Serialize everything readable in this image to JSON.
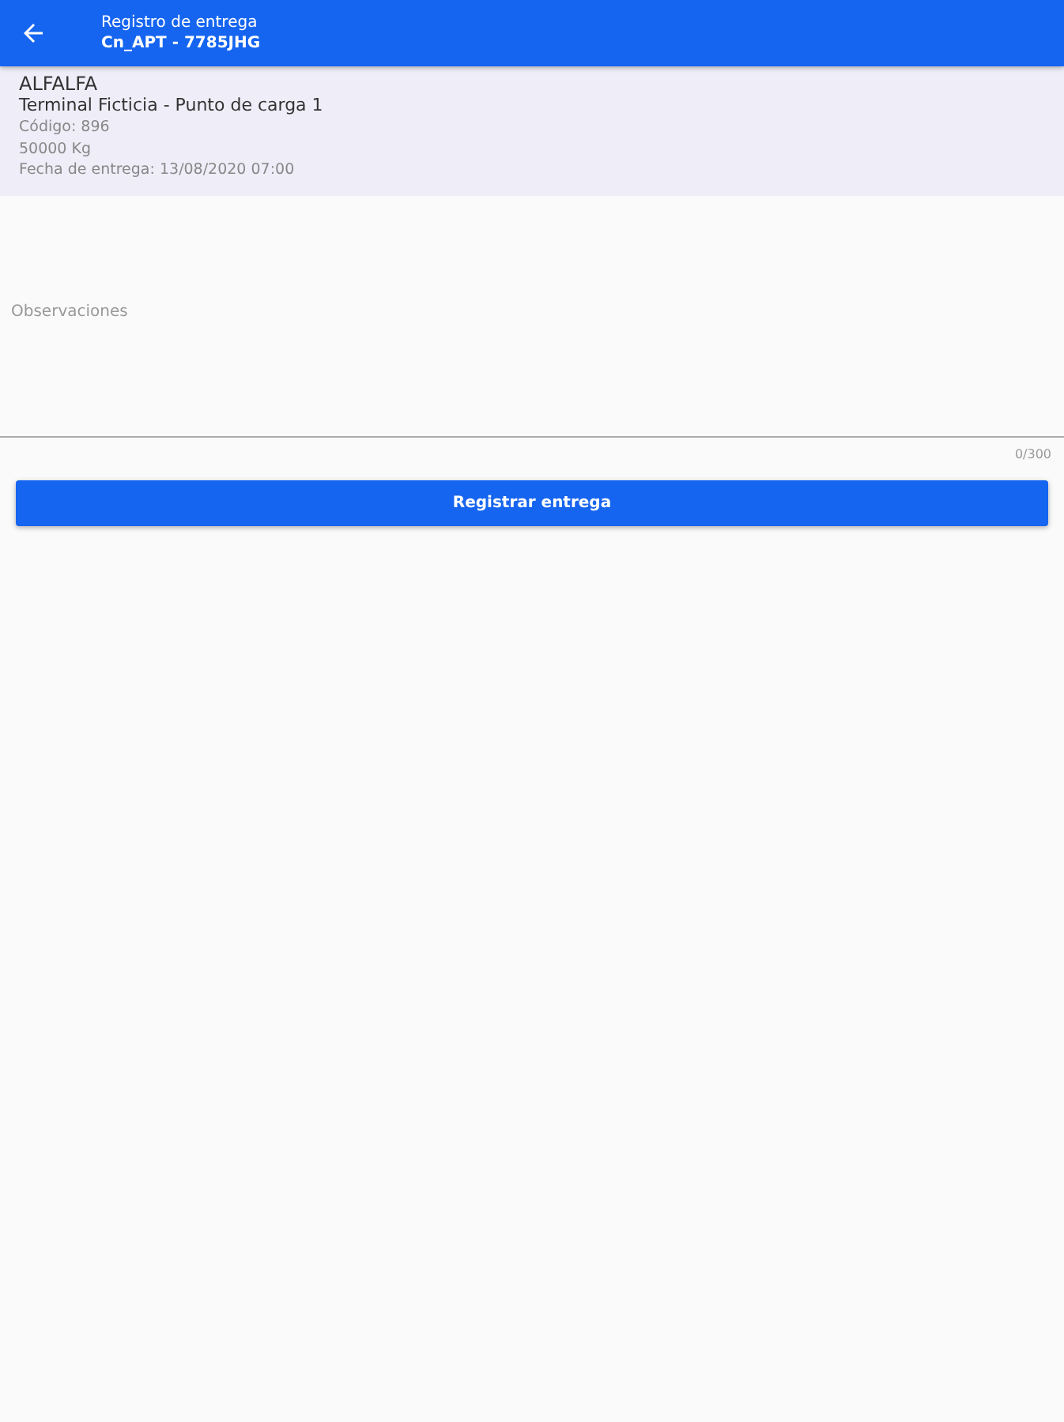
{
  "app_bar": {
    "title": "Registro de entrega",
    "subtitle": "Cn_APT - 7785JHG"
  },
  "delivery": {
    "product": "ALFALFA",
    "location": "Terminal Ficticia - Punto de carga 1",
    "code": "Código: 896",
    "weight": "50000 Kg",
    "date": "Fecha de entrega: 13/08/2020 07:00"
  },
  "observations": {
    "placeholder": "Observaciones",
    "counter": "0/300"
  },
  "submit_button": {
    "label": "Registrar entrega"
  }
}
